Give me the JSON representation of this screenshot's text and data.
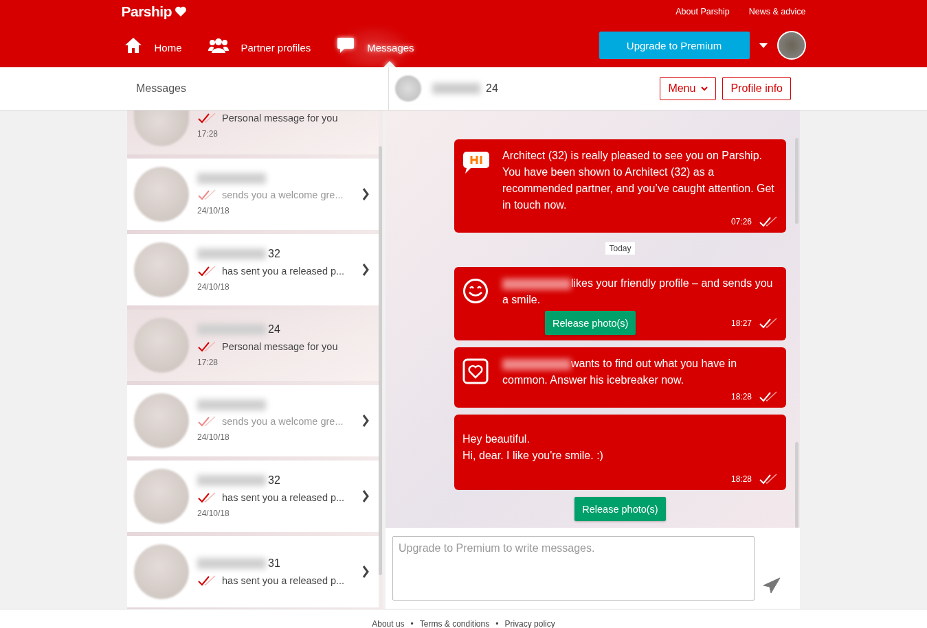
{
  "header": {
    "logo": "Parship",
    "top_links": [
      "About Parship",
      "News & advice"
    ],
    "nav": [
      {
        "kind": "home",
        "label": "Home",
        "selected": false
      },
      {
        "kind": "people",
        "label": "Partner profiles",
        "selected": false
      },
      {
        "kind": "chat",
        "label": "Messages",
        "selected": true
      }
    ],
    "upgrade_button": "Upgrade to Premium"
  },
  "subheader": {
    "title": "Messages",
    "contact_age": "24",
    "menu_button": "Menu",
    "profile_button": "Profile info"
  },
  "conversations": [
    {
      "name_blurred": false,
      "preview": "Personal message for you",
      "time": "17:28",
      "selected": true,
      "muted": false
    },
    {
      "name_blurred": true,
      "preview": "sends you a welcome gre...",
      "time": "24/10/18",
      "selected": false,
      "muted": true
    },
    {
      "name_blurred": true,
      "age": "32",
      "preview": "has sent you a released p...",
      "time": "24/10/18",
      "selected": false,
      "muted": false
    },
    {
      "name_blurred": true,
      "age": "24",
      "preview": "Personal message for you",
      "time": "17:28",
      "selected": true,
      "muted": false
    },
    {
      "name_blurred": true,
      "preview": "sends you a welcome gre...",
      "time": "24/10/18",
      "selected": false,
      "muted": true
    },
    {
      "name_blurred": true,
      "age": "32",
      "preview": "has sent you a released p...",
      "time": "24/10/18",
      "selected": false,
      "muted": false
    },
    {
      "name_blurred": true,
      "age": "31",
      "preview": "has sent you a released p...",
      "selected": false,
      "muted": false
    }
  ],
  "messages": [
    {
      "kind": "greeting",
      "name_blurred": false,
      "text": "Architect (32) is really pleased to see you on Parship. You have been shown to Architect (32) as a recommended partner, and you’ve caught attention. Get in touch now.",
      "time": "07:26"
    },
    {
      "kind": "date",
      "text": "Today"
    },
    {
      "kind": "smile",
      "name_blurred": true,
      "text": "likes your friendly profile – and sends you a smile.",
      "button": "Release photo(s)",
      "time": "18:27"
    },
    {
      "kind": "icebreaker",
      "name_blurred": true,
      "text": "wants to find out what you have in common. Answer his icebreaker now.",
      "time": "18:28"
    },
    {
      "kind": "text",
      "lines": [
        "Hey beautiful.",
        "Hi, dear. I like you're smile. :)"
      ],
      "time": "18:28"
    },
    {
      "kind": "action",
      "button": "Release photo(s)"
    }
  ],
  "composer": {
    "placeholder": "Upgrade to Premium to write messages."
  },
  "footer": {
    "links": [
      "About us",
      "Terms & conditions",
      "Privacy policy"
    ],
    "separator": "•"
  }
}
